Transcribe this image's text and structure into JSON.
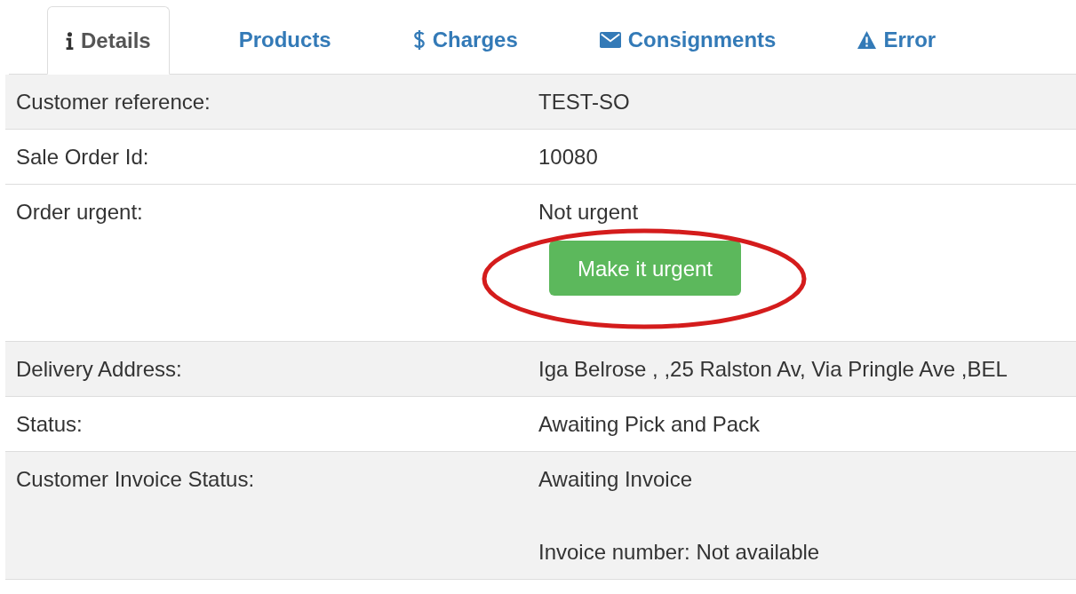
{
  "tabs": [
    {
      "label": "Details",
      "kind": "info",
      "selected": true
    },
    {
      "label": "Products",
      "kind": "plain",
      "selected": false
    },
    {
      "label": "Charges",
      "kind": "dollar",
      "selected": false
    },
    {
      "label": "Consignments",
      "kind": "envelope",
      "selected": false
    },
    {
      "label": "Error",
      "kind": "warning",
      "selected": false
    }
  ],
  "rows": [
    {
      "label": "Customer reference:",
      "shaded": true,
      "values": [
        "TEST-SO"
      ]
    },
    {
      "label": "Sale Order Id:",
      "shaded": false,
      "values": [
        "10080"
      ]
    },
    {
      "label": "Order urgent:",
      "shaded": false,
      "values": [
        "Not urgent"
      ],
      "button": "Make it urgent",
      "highlighted": true
    },
    {
      "label": "Delivery Address:",
      "shaded": true,
      "values": [
        "Iga Belrose , ,25 Ralston Av, Via Pringle Ave ,BEL"
      ]
    },
    {
      "label": "Status:",
      "shaded": false,
      "values": [
        "Awaiting Pick and Pack"
      ]
    },
    {
      "label": "Customer Invoice Status:",
      "shaded": true,
      "values": [
        "Awaiting Invoice",
        "Invoice number: Not available"
      ]
    }
  ]
}
